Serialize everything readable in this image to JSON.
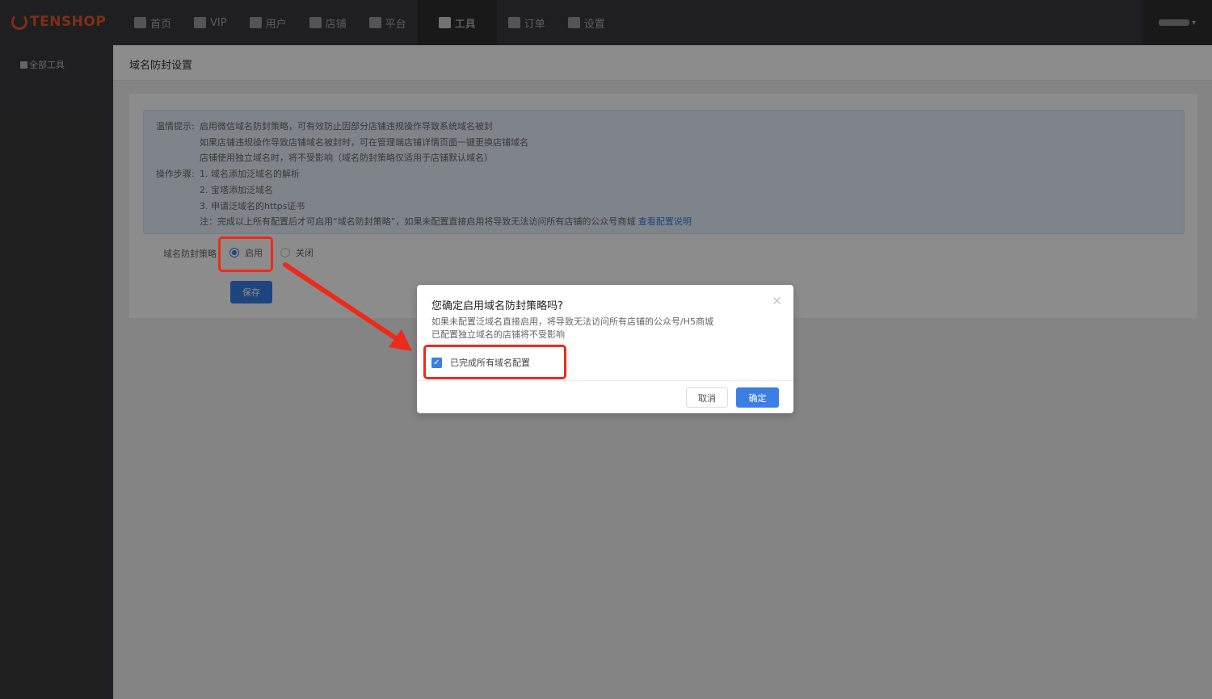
{
  "brand": {
    "logo_text": "TENSHOP",
    "accent": "#e8542c"
  },
  "nav": {
    "items": [
      {
        "label": "首页",
        "icon": "home-icon"
      },
      {
        "label": "VIP",
        "icon": "diamond-icon"
      },
      {
        "label": "用户",
        "icon": "users-icon"
      },
      {
        "label": "店铺",
        "icon": "store-icon"
      },
      {
        "label": "平台",
        "icon": "cube-icon"
      },
      {
        "label": "工具",
        "icon": "toolbox-icon",
        "active": true
      },
      {
        "label": "订单",
        "icon": "document-icon"
      },
      {
        "label": "设置",
        "icon": "gear-icon"
      }
    ]
  },
  "sidebar": {
    "items": [
      {
        "label": "全部工具",
        "icon": "lock-icon"
      }
    ]
  },
  "page": {
    "title": "域名防封设置"
  },
  "tips": {
    "label_tip": "温情提示:",
    "tip_lines": [
      "启用微信域名防封策略，可有效防止因部分店铺违规操作导致系统域名被封",
      "如果店铺违规操作导致店铺域名被封时，可在管理端店铺详情页面一键更换店铺域名",
      "店铺使用独立域名时，将不受影响（域名防封策略仅适用于店铺默认域名）"
    ],
    "label_steps": "操作步骤:",
    "step_lines": [
      "1. 域名添加泛域名的解析",
      "2. 宝塔添加泛域名",
      "3. 申请泛域名的https证书",
      "注：完成以上所有配置后才可启用“域名防封策略”，如果未配置直接启用将导致无法访问所有店铺的公众号商城"
    ],
    "link_text": "查看配置说明"
  },
  "form": {
    "label": "域名防封策略",
    "options": [
      "启用",
      "关闭"
    ],
    "selected": "启用",
    "save_label": "保存"
  },
  "modal": {
    "title": "您确定启用域名防封策略吗?",
    "lines": [
      "如果未配置泛域名直接启用，将导致无法访问所有店铺的公众号/H5商城",
      "已配置独立域名的店铺将不受影响"
    ],
    "checkbox_label": "已完成所有域名配置",
    "checkbox_checked": true,
    "cancel_label": "取消",
    "ok_label": "确定"
  },
  "colors": {
    "primary": "#3a7ee6",
    "highlight": "#ee2a1a"
  }
}
